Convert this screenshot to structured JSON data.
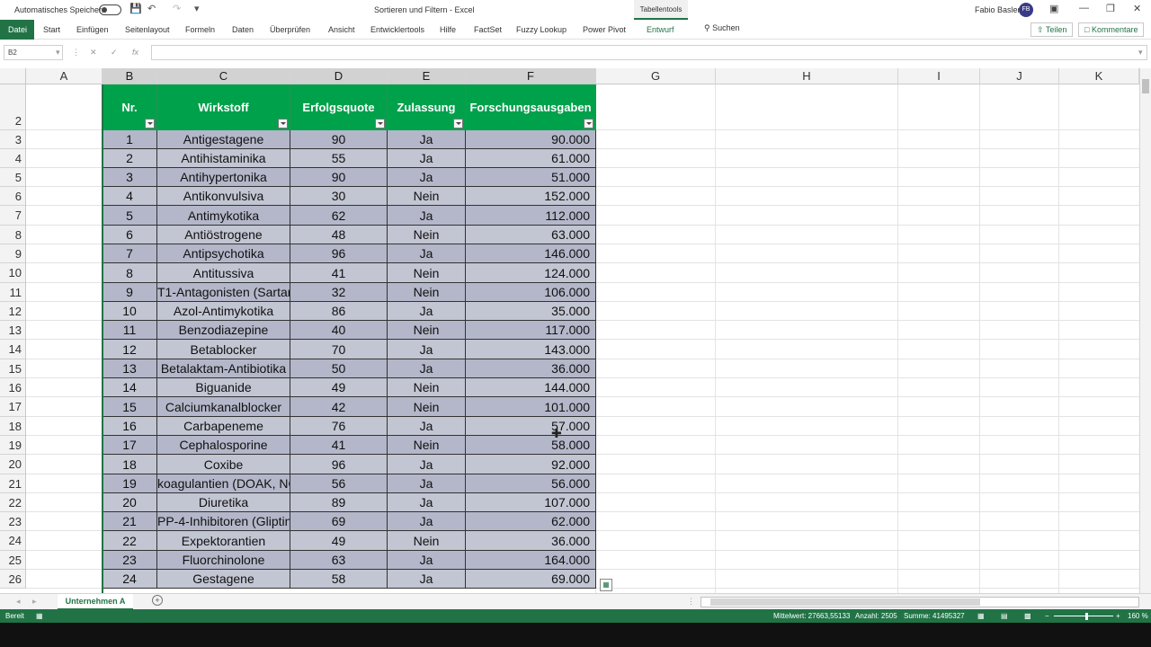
{
  "title_bar": {
    "autosave_label": "Automatisches Speichern",
    "title": "Sortieren und Filtern  -  Excel",
    "table_tools": "Tabellentools",
    "user_name": "Fabio Basler",
    "user_initials": "FB"
  },
  "ribbon": {
    "tabs": [
      "Datei",
      "Start",
      "Einfügen",
      "Seitenlayout",
      "Formeln",
      "Daten",
      "Überprüfen",
      "Ansicht",
      "Entwicklertools",
      "Hilfe",
      "FactSet",
      "Fuzzy Lookup",
      "Power Pivot",
      "Entwurf"
    ],
    "search": "Suchen",
    "share": "Teilen",
    "comments": "Kommentare"
  },
  "formula_bar": {
    "name_box": "B2",
    "formula": ""
  },
  "columns": [
    "A",
    "B",
    "C",
    "D",
    "E",
    "F",
    "G",
    "H",
    "I",
    "J",
    "K"
  ],
  "table": {
    "header_row": "2",
    "headers": [
      "Nr.",
      "Wirkstoff",
      "Erfolgsquote",
      "Zulassung",
      "Forschungsausgaben"
    ],
    "rows": [
      {
        "row": "3",
        "cells": [
          "1",
          "Antigestagene",
          "90",
          "Ja",
          "90.000"
        ]
      },
      {
        "row": "4",
        "cells": [
          "2",
          "Antihistaminika",
          "55",
          "Ja",
          "61.000"
        ]
      },
      {
        "row": "5",
        "cells": [
          "3",
          "Antihypertonika",
          "90",
          "Ja",
          "51.000"
        ]
      },
      {
        "row": "6",
        "cells": [
          "4",
          "Antikonvulsiva",
          "30",
          "Nein",
          "152.000"
        ]
      },
      {
        "row": "7",
        "cells": [
          "5",
          "Antimykotika",
          "62",
          "Ja",
          "112.000"
        ]
      },
      {
        "row": "8",
        "cells": [
          "6",
          "Antiöstrogene",
          "48",
          "Nein",
          "63.000"
        ]
      },
      {
        "row": "9",
        "cells": [
          "7",
          "Antipsychotika",
          "96",
          "Ja",
          "146.000"
        ]
      },
      {
        "row": "10",
        "cells": [
          "8",
          "Antitussiva",
          "41",
          "Nein",
          "124.000"
        ]
      },
      {
        "row": "11",
        "cells": [
          "9",
          "T1-Antagonisten (Sartan",
          "32",
          "Nein",
          "106.000"
        ]
      },
      {
        "row": "12",
        "cells": [
          "10",
          "Azol-Antimykotika",
          "86",
          "Ja",
          "35.000"
        ]
      },
      {
        "row": "13",
        "cells": [
          "11",
          "Benzodiazepine",
          "40",
          "Nein",
          "117.000"
        ]
      },
      {
        "row": "14",
        "cells": [
          "12",
          "Betablocker",
          "70",
          "Ja",
          "143.000"
        ]
      },
      {
        "row": "15",
        "cells": [
          "13",
          "Betalaktam-Antibiotika",
          "50",
          "Ja",
          "36.000"
        ]
      },
      {
        "row": "16",
        "cells": [
          "14",
          "Biguanide",
          "49",
          "Nein",
          "144.000"
        ]
      },
      {
        "row": "17",
        "cells": [
          "15",
          "Calciumkanalblocker",
          "42",
          "Nein",
          "101.000"
        ]
      },
      {
        "row": "18",
        "cells": [
          "16",
          "Carbapeneme",
          "76",
          "Ja",
          "57.000"
        ]
      },
      {
        "row": "19",
        "cells": [
          "17",
          "Cephalosporine",
          "41",
          "Nein",
          "58.000"
        ]
      },
      {
        "row": "20",
        "cells": [
          "18",
          "Coxibe",
          "96",
          "Ja",
          "92.000"
        ]
      },
      {
        "row": "21",
        "cells": [
          "19",
          "koagulantien (DOAK, NC",
          "56",
          "Ja",
          "56.000"
        ]
      },
      {
        "row": "22",
        "cells": [
          "20",
          "Diuretika",
          "89",
          "Ja",
          "107.000"
        ]
      },
      {
        "row": "23",
        "cells": [
          "21",
          "PP-4-Inhibitoren (Gliptin",
          "69",
          "Ja",
          "62.000"
        ]
      },
      {
        "row": "24",
        "cells": [
          "22",
          "Expektorantien",
          "49",
          "Nein",
          "36.000"
        ]
      },
      {
        "row": "25",
        "cells": [
          "23",
          "Fluorchinolone",
          "63",
          "Ja",
          "164.000"
        ]
      },
      {
        "row": "26",
        "cells": [
          "24",
          "Gestagene",
          "58",
          "Ja",
          "69.000"
        ]
      }
    ]
  },
  "sheet_tab": "Unternehmen A",
  "status_bar": {
    "ready": "Bereit",
    "average": "Mittelwert: 27663,55133",
    "count": "Anzahl: 2505",
    "sum": "Summe: 41495327",
    "zoom": "160 %"
  },
  "colors": {
    "excel_green": "#217346",
    "table_header": "#00a14b",
    "band_a": "#b3b7c9",
    "band_b": "#c2c5d2"
  }
}
